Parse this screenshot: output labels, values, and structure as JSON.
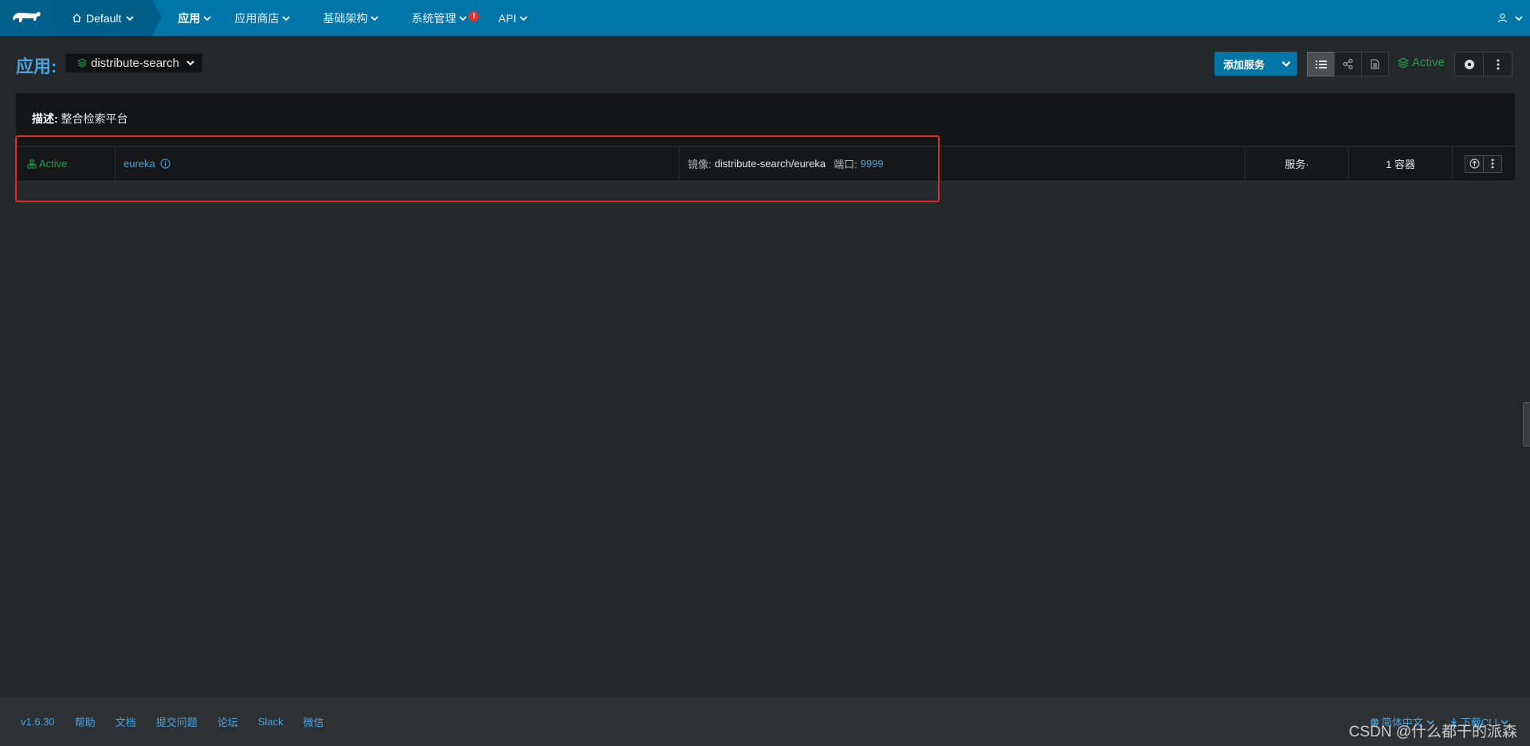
{
  "nav": {
    "environment": "Default",
    "items": [
      {
        "label": "应用",
        "active": true
      },
      {
        "label": "应用商店",
        "active": false
      },
      {
        "label": "基础架构",
        "active": false
      },
      {
        "label": "系统管理",
        "active": false,
        "alert": "!"
      },
      {
        "label": "API",
        "active": false
      }
    ]
  },
  "header": {
    "title": "应用:",
    "stack_name": "distribute-search",
    "add_service_label": "添加服务",
    "status": "Active"
  },
  "stack": {
    "description_label": "描述:",
    "description_value": "整合检索平台",
    "service": {
      "status": "Active",
      "name": "eureka",
      "image_label": "镜像:",
      "image_value": "distribute-search/eureka",
      "port_label": "端口:",
      "port_value": "9999",
      "kind": "服务·",
      "containers": "1 容器"
    }
  },
  "footer": {
    "links": [
      "v1.6.30",
      "帮助",
      "文档",
      "提交问题",
      "论坛",
      "Slack",
      "微信"
    ],
    "language": "简体中文",
    "download": "下载CLI"
  },
  "watermark": "CSDN @什么都干的派森",
  "colors": {
    "nav_bg": "#0075a8",
    "accent": "#4aa3df",
    "active_green": "#16a34a",
    "highlight_red": "#e02a22"
  }
}
